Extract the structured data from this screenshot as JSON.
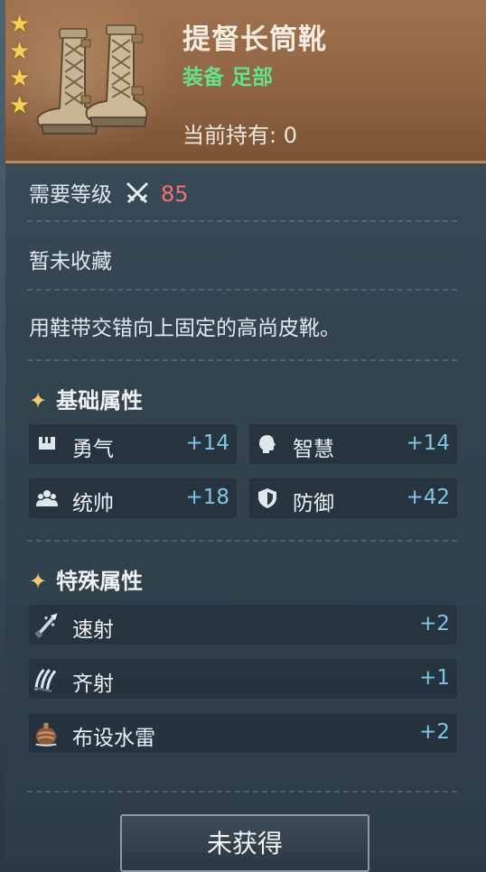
{
  "item": {
    "name": "提督长筒靴",
    "category": "装备 足部",
    "owned_label": "当前持有:",
    "owned_count": "0",
    "rarity_stars": 4
  },
  "requirement": {
    "label": "需要等级",
    "value": "85"
  },
  "collection_status": "暂未收藏",
  "description": "用鞋带交错向上固定的高尚皮靴。",
  "basic_attributes": {
    "title": "基础属性",
    "items": [
      {
        "name": "勇气",
        "value": "+14",
        "icon": "courage-icon"
      },
      {
        "name": "智慧",
        "value": "+14",
        "icon": "wisdom-icon"
      },
      {
        "name": "统帅",
        "value": "+18",
        "icon": "command-icon"
      },
      {
        "name": "防御",
        "value": "+42",
        "icon": "defense-icon"
      }
    ]
  },
  "special_attributes": {
    "title": "特殊属性",
    "items": [
      {
        "name": "速射",
        "value": "+2",
        "icon": "rapid-fire-icon"
      },
      {
        "name": "齐射",
        "value": "+1",
        "icon": "volley-icon"
      },
      {
        "name": "布设水雷",
        "value": "+2",
        "icon": "naval-mine-icon"
      }
    ]
  },
  "action_button": "未获得",
  "colors": {
    "header": "#8e6443",
    "quality_green": "#66e08e",
    "level_red": "#f07272",
    "stat_blue": "#7fc6e4",
    "star_gold": "#f7cf55"
  }
}
